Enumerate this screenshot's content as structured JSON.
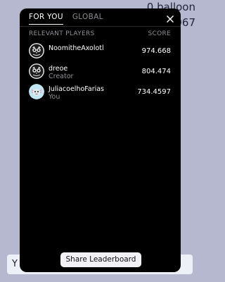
{
  "background": {
    "balloon_text": "0 balloon",
    "score_text": "967",
    "bottom_label": "Y"
  },
  "tabs": [
    {
      "label": "FOR YOU",
      "active": true
    },
    {
      "label": "GLOBAL",
      "active": false
    }
  ],
  "header": {
    "players_label": "RELEVANT PLAYERS",
    "score_label": "SCORE"
  },
  "players": [
    {
      "name": "NoomitheAxolotl",
      "subtitle": "",
      "score": "974.668",
      "avatar": "owl-avatar-icon"
    },
    {
      "name": "dreoe",
      "subtitle": "Creator",
      "score": "804.474",
      "avatar": "owl-avatar-icon"
    },
    {
      "name": "JuliacoelhoFarias",
      "subtitle": "You",
      "score": "734.4597",
      "avatar": "axolotl-avatar-icon"
    }
  ],
  "share_button": {
    "label": "Share Leaderboard"
  },
  "colors": {
    "modal_bg": "#000000",
    "page_bg": "#b6b8cf",
    "muted": "#8f8f96"
  }
}
